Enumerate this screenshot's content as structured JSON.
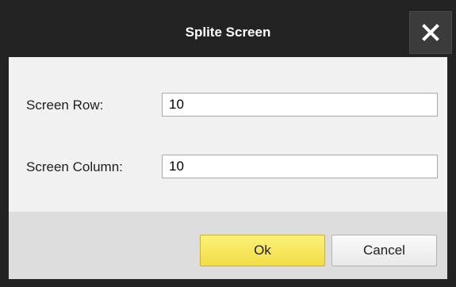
{
  "dialog": {
    "title": "Splite Screen",
    "close_icon": "close-icon"
  },
  "fields": {
    "row": {
      "label": "Screen Row:",
      "value": "10"
    },
    "column": {
      "label": "Screen Column:",
      "value": "10"
    }
  },
  "buttons": {
    "ok_label": "Ok",
    "cancel_label": "Cancel"
  },
  "colors": {
    "title_bar": "#232323",
    "ok_button": "#f2dd45",
    "content_bg": "#f1f1f1",
    "footer_bg": "#dddddd"
  }
}
